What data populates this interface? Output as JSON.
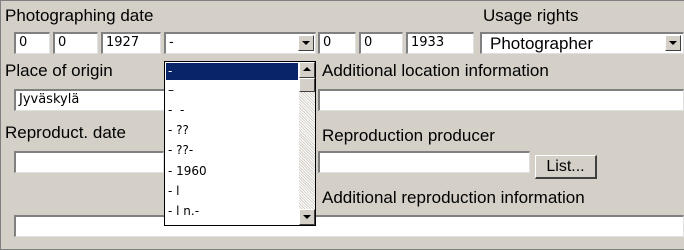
{
  "labels": {
    "photographing_date": "Photographing date",
    "usage_rights": "Usage rights",
    "place_of_origin": "Place of origin",
    "additional_location": "Additional location information",
    "reproduct_date": "Reproduct. date",
    "reproduction_producer": "Reproduction producer",
    "additional_reproduction": "Additional reproduction information"
  },
  "date_from": {
    "day": "0",
    "month": "0",
    "year": "1927"
  },
  "date_separator_select": {
    "value": "-"
  },
  "date_to": {
    "day": "0",
    "month": "0",
    "year": "1933"
  },
  "usage_rights_select": {
    "value": "Photographer"
  },
  "place_of_origin_value": "Jyväskylä",
  "additional_location_value": "",
  "reproduct_date_value": "",
  "reproduction_producer_value": "",
  "list_button_label": "List...",
  "additional_reproduction_value": "",
  "dropdown_options": [
    "-",
    "–",
    "-  -",
    "- ??",
    "- ??-",
    "- 1960",
    "- l",
    "- l n.-"
  ],
  "dropdown_selected_index": 0,
  "colors": {
    "background": "#d4d0c8",
    "selection": "#0a246a"
  }
}
